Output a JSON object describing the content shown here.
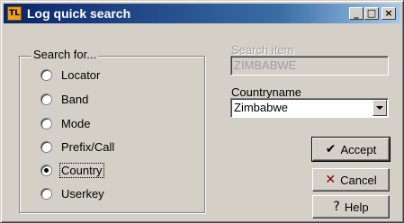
{
  "window": {
    "title": "Log quick search",
    "app_icon_text": "TL",
    "controls": {
      "minimize": "_",
      "maximize": "□",
      "close": "×"
    }
  },
  "search_for": {
    "legend": "Search for...",
    "options": [
      {
        "label": "Locator",
        "checked": false
      },
      {
        "label": "Band",
        "checked": false
      },
      {
        "label": "Mode",
        "checked": false
      },
      {
        "label": "Prefix/Call",
        "checked": false
      },
      {
        "label": "Country",
        "checked": true
      },
      {
        "label": "Userkey",
        "checked": false
      }
    ]
  },
  "search_item": {
    "label": "Search item",
    "value": "ZIMBABWE"
  },
  "countryname": {
    "label": "Countryname",
    "selected": "Zimbabwe"
  },
  "buttons": {
    "accept": {
      "label": "Accept",
      "icon": "check-icon"
    },
    "cancel": {
      "label": "Cancel",
      "icon": "cross-icon"
    },
    "help": {
      "label": "Help",
      "icon": "help-icon"
    }
  }
}
